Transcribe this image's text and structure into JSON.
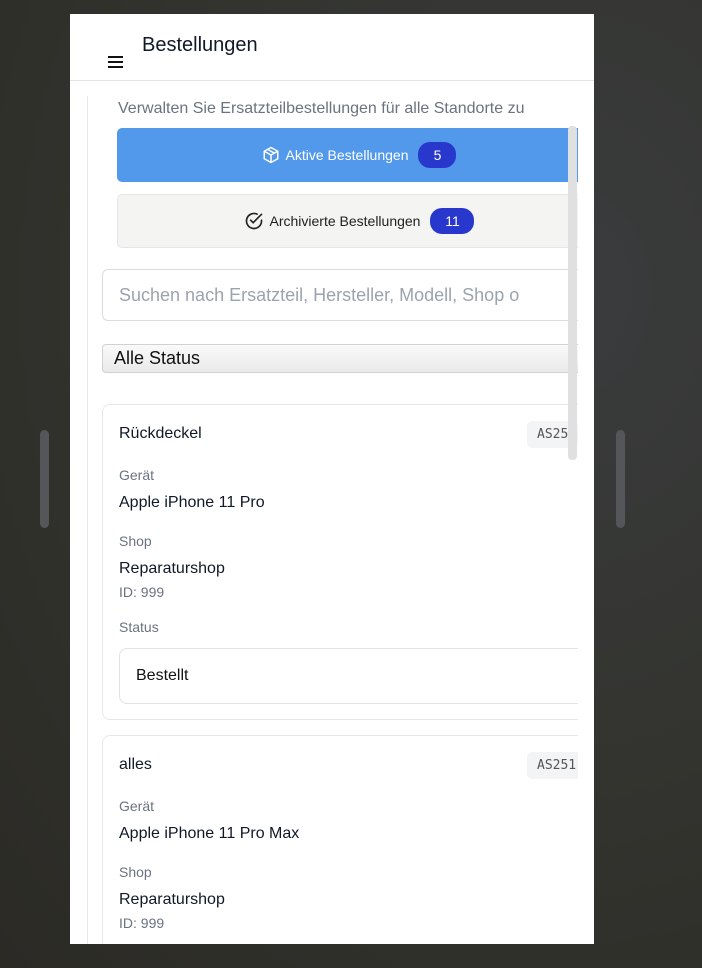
{
  "header": {
    "title": "Bestellungen"
  },
  "subtitle": "Verwalten Sie Ersatzteilbestellungen für alle Standorte zu",
  "tabs": [
    {
      "label": "Aktive Bestellungen",
      "count": "5",
      "icon": "package-icon",
      "active": true
    },
    {
      "label": "Archivierte Bestellungen",
      "count": "11",
      "icon": "check-circle-icon",
      "active": false
    }
  ],
  "search": {
    "placeholder": "Suchen nach Ersatzteil, Hersteller, Modell, Shop o"
  },
  "status_filter": {
    "value": "Alle Status"
  },
  "orders": [
    {
      "name": "Rückdeckel",
      "code": "AS25",
      "device_label": "Gerät",
      "device": "Apple iPhone 11 Pro",
      "shop_label": "Shop",
      "shop": "Reparaturshop",
      "shop_id": "ID: 999",
      "status_label": "Status",
      "status": "Bestellt"
    },
    {
      "name": "alles",
      "code": "AS251",
      "device_label": "Gerät",
      "device": "Apple iPhone 11 Pro Max",
      "shop_label": "Shop",
      "shop": "Reparaturshop",
      "shop_id": "ID: 999"
    }
  ],
  "colors": {
    "active_tab": "#5299ec",
    "badge": "#2837cc"
  }
}
